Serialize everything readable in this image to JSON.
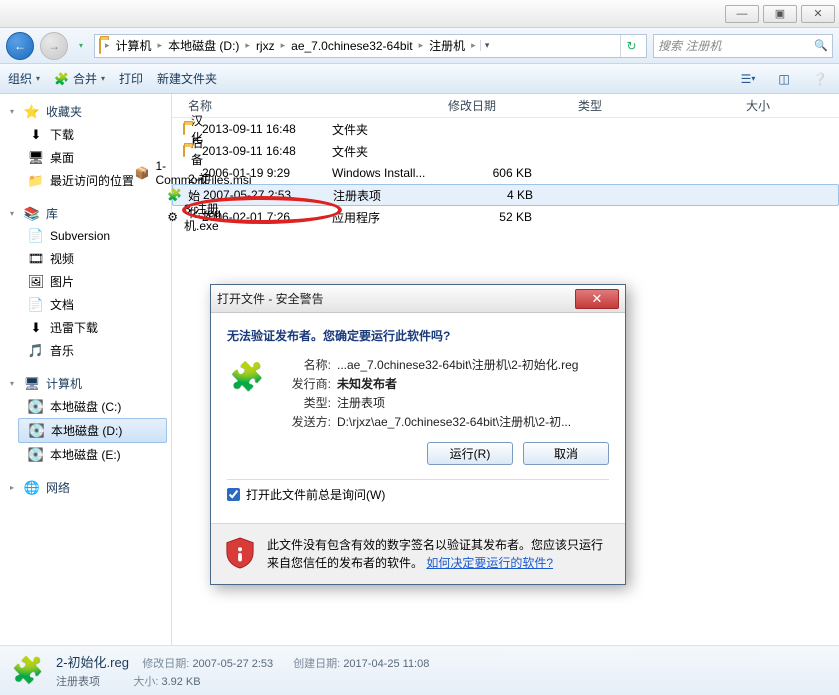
{
  "titlebar": {
    "min": "—",
    "max": "▣",
    "close": "✕"
  },
  "nav": {
    "back_glyph": "←",
    "fwd_glyph": "→"
  },
  "breadcrumb": [
    {
      "label": "计算机"
    },
    {
      "label": "本地磁盘 (D:)"
    },
    {
      "label": "rjxz"
    },
    {
      "label": "ae_7.0chinese32-64bit"
    },
    {
      "label": "注册机"
    }
  ],
  "search": {
    "placeholder": "搜索 注册机"
  },
  "toolbar": {
    "organize": "组织",
    "merge": "合并",
    "print": "打印",
    "newfolder": "新建文件夹"
  },
  "sidebar": {
    "fav_head": "收藏夹",
    "fav": [
      {
        "label": "下载",
        "icon": "⬇"
      },
      {
        "label": "桌面",
        "icon": "🖥"
      },
      {
        "label": "最近访问的位置",
        "icon": "📁"
      }
    ],
    "lib_head": "库",
    "lib": [
      {
        "label": "Subversion",
        "icon": "📄"
      },
      {
        "label": "视频",
        "icon": "🎞"
      },
      {
        "label": "图片",
        "icon": "🖼"
      },
      {
        "label": "文档",
        "icon": "📄"
      },
      {
        "label": "迅雷下载",
        "icon": "⬇"
      },
      {
        "label": "音乐",
        "icon": "🎵"
      }
    ],
    "comp_head": "计算机",
    "drives": [
      {
        "label": "本地磁盘 (C:)",
        "icon": "💽",
        "selected": false
      },
      {
        "label": "本地磁盘 (D:)",
        "icon": "💽",
        "selected": true
      },
      {
        "label": "本地磁盘 (E:)",
        "icon": "💽",
        "selected": false
      }
    ],
    "net_head": "网络"
  },
  "columns": {
    "name": "名称",
    "date": "修改日期",
    "type": "类型",
    "size": "大小"
  },
  "files": [
    {
      "name": "汉化",
      "date": "2013-09-11 16:48",
      "type": "文件夹",
      "size": "",
      "icon": "folder"
    },
    {
      "name": "后备",
      "date": "2013-09-11 16:48",
      "type": "文件夹",
      "size": "",
      "icon": "folder"
    },
    {
      "name": "1-CommonFiles.msi",
      "date": "2006-01-19 9:29",
      "type": "Windows Install...",
      "size": "606 KB",
      "icon": "msi"
    },
    {
      "name": "2-初始化.reg",
      "date": "2007-05-27 2:53",
      "type": "注册表项",
      "size": "4 KB",
      "icon": "reg",
      "selected": true
    },
    {
      "name": "3-注册机.exe",
      "date": "2006-02-01 7:26",
      "type": "应用程序",
      "size": "52 KB",
      "icon": "exe"
    }
  ],
  "dialog": {
    "title": "打开文件 - 安全警告",
    "heading": "无法验证发布者。您确定要运行此软件吗?",
    "labels": {
      "name": "名称:",
      "publisher": "发行商:",
      "type": "类型:",
      "from": "发送方:"
    },
    "values": {
      "name": "...ae_7.0chinese32-64bit\\注册机\\2-初始化.reg",
      "publisher": "未知发布者",
      "type": "注册表项",
      "from": "D:\\rjxz\\ae_7.0chinese32-64bit\\注册机\\2-初..."
    },
    "run": "运行(R)",
    "cancel": "取消",
    "always_ask": "打开此文件前总是询问(W)",
    "warn_text": "此文件没有包含有效的数字签名以验证其发布者。您应该只运行来自您信任的发布者的软件。",
    "warn_link": "如何决定要运行的软件?"
  },
  "status": {
    "filename": "2-初始化.reg",
    "filetype": "注册表项",
    "mod_label": "修改日期:",
    "mod_value": "2007-05-27 2:53",
    "size_label": "大小:",
    "size_value": "3.92 KB",
    "create_label": "创建日期:",
    "create_value": "2017-04-25 11:08"
  }
}
